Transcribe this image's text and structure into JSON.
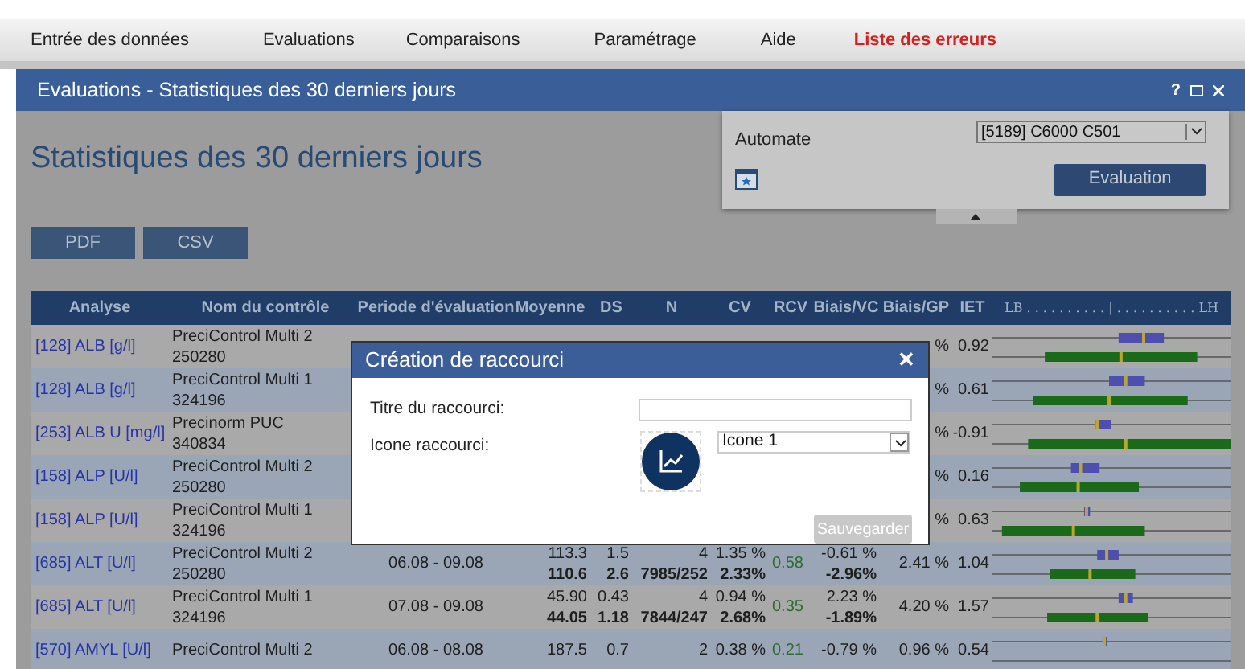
{
  "menu": [
    {
      "label": "Entrée des données",
      "kind": "normal"
    },
    {
      "label": "Evaluations",
      "kind": "normal"
    },
    {
      "label": "Comparaisons",
      "kind": "normal"
    },
    {
      "label": "Paramétrage",
      "kind": "normal"
    },
    {
      "label": "Aide",
      "kind": "normal"
    },
    {
      "label": "Liste des erreurs",
      "kind": "alert"
    }
  ],
  "window": {
    "title": "Evaluations - Statistiques des 30 derniers jours",
    "help": "?"
  },
  "heading": "Statistiques des 30 derniers jours",
  "automate": {
    "label": "Automate",
    "value": "[5189] C6000 C501",
    "button": "Evaluation"
  },
  "exports": [
    "PDF",
    "CSV"
  ],
  "table": {
    "columns": [
      "Analyse",
      "Nom du contrôle",
      "Periode d'évaluation",
      "Moyenne",
      "DS",
      "N",
      "CV",
      "RCV",
      "Biais/VC",
      "Biais/GP",
      "IET",
      "LB . . . . . . . . . . | . . . . . . . . . . LH"
    ],
    "rows": [
      {
        "analyse": "[128]  ALB [g/l]",
        "control": [
          "PreciControl Multi 2",
          "250280"
        ],
        "bias_gp": "%",
        "iet": "0.92"
      },
      {
        "analyse": "[128]  ALB [g/l]",
        "control": [
          "PreciControl Multi 1",
          "324196"
        ],
        "bias_gp": "%",
        "iet": "0.61"
      },
      {
        "analyse": "[253]  ALB U [mg/l]",
        "control": [
          "Precinorm PUC",
          "340834"
        ],
        "bias_gp": "%",
        "iet": "-0.91"
      },
      {
        "analyse": "[158]  ALP [U/l]",
        "control": [
          "PreciControl Multi 2",
          "250280"
        ],
        "bias_gp": "%",
        "iet": "0.16"
      },
      {
        "analyse": "[158]  ALP [U/l]",
        "control": [
          "PreciControl Multi 1",
          "324196"
        ],
        "bias_gp": "%",
        "iet": "0.63"
      },
      {
        "analyse": "[685]  ALT [U/l]",
        "control": [
          "PreciControl Multi 2",
          "250280"
        ],
        "period": "06.08 - 09.08",
        "mean": [
          "113.3",
          "110.6"
        ],
        "ds": [
          "1.5",
          "2.6"
        ],
        "n": [
          "4",
          "7985/252"
        ],
        "cv": [
          "1.35 %",
          "2.33%"
        ],
        "rcv": "0.58",
        "bias_vc": [
          "-0.61 %",
          "-2.96%"
        ],
        "bias_gp": "2.41 %",
        "iet": "1.04"
      },
      {
        "analyse": "[685]  ALT [U/l]",
        "control": [
          "PreciControl Multi 1",
          "324196"
        ],
        "period": "07.08 - 09.08",
        "mean": [
          "45.90",
          "44.05"
        ],
        "ds": [
          "0.43",
          "1.18"
        ],
        "n": [
          "4",
          "7844/247"
        ],
        "cv": [
          "0.94 %",
          "2.68%"
        ],
        "rcv": "0.35",
        "bias_vc": [
          "2.23 %",
          "-1.89%"
        ],
        "bias_gp": "4.20 %",
        "iet": "1.57"
      },
      {
        "analyse": "[570]  AMYL [U/l]",
        "control": [
          "PreciControl Multi 2"
        ],
        "period": "06.08 - 08.08",
        "mean": [
          "187.5"
        ],
        "ds": [
          "0.7"
        ],
        "n": [
          "2"
        ],
        "cv": [
          "0.38 %"
        ],
        "rcv": "0.21",
        "bias_vc": [
          "-0.79 %"
        ],
        "bias_gp": "0.96 %",
        "iet": "0.54"
      }
    ]
  },
  "dialog": {
    "title": "Création de raccourci",
    "close": "✕",
    "fields": [
      {
        "label": "Titre du raccourci:",
        "kind": "text"
      },
      {
        "label": "Icone raccourci:",
        "kind": "icon",
        "value": "Icone 1"
      }
    ],
    "save": {
      "label": "Sauvegarder",
      "disabled": true
    }
  }
}
